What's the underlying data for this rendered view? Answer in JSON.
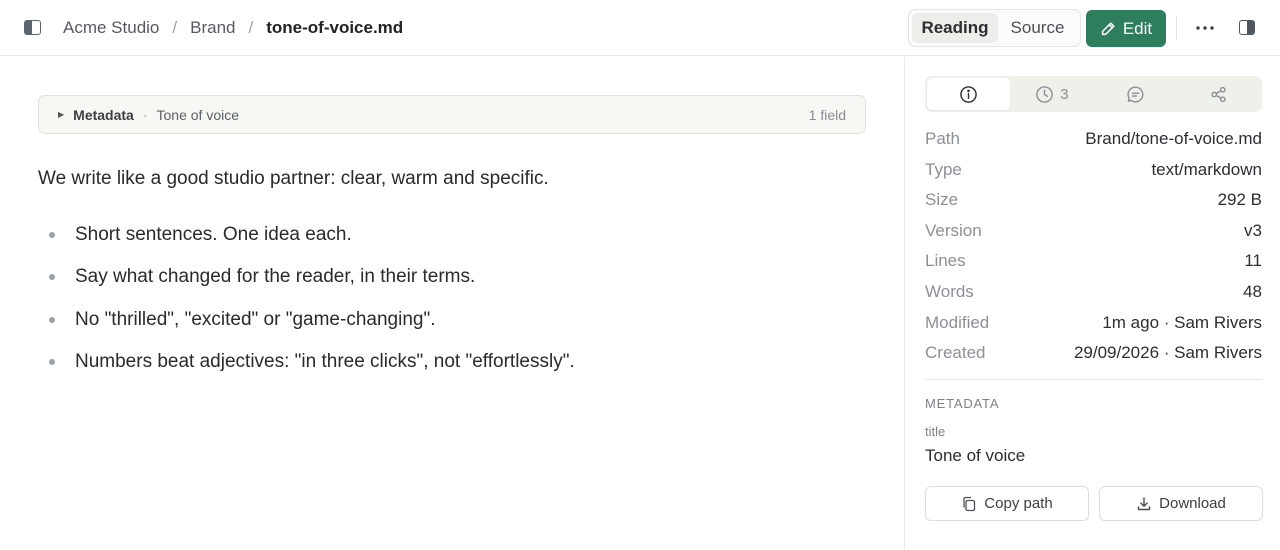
{
  "breadcrumb": [
    "Acme Studio",
    "Brand",
    "tone-of-voice.md"
  ],
  "toolbar": {
    "reading_label": "Reading",
    "source_label": "Source",
    "edit_label": "Edit",
    "accent_color": "#2e7d5c"
  },
  "metadata_bar": {
    "label": "Metadata",
    "title": "Tone of voice",
    "count": "1 field"
  },
  "document": {
    "paragraph": "We write like a good studio partner: clear, warm and specific.",
    "bullets": [
      "Short sentences. One idea each.",
      "Say what changed for the reader, in their terms.",
      "No \"thrilled\", \"excited\" or \"game-changing\".",
      "Numbers beat adjectives: \"in three clicks\", not \"effortlessly\"."
    ]
  },
  "panel": {
    "tabs": [
      {
        "icon": "info-icon",
        "count": ""
      },
      {
        "icon": "history-icon",
        "count": "3"
      },
      {
        "icon": "comment-icon",
        "count": ""
      },
      {
        "icon": "share-icon",
        "count": ""
      }
    ],
    "properties": [
      {
        "key": "Path",
        "value": "Brand/tone-of-voice.md"
      },
      {
        "key": "Type",
        "value": "text/markdown"
      },
      {
        "key": "Size",
        "value": "292 B"
      },
      {
        "key": "Version",
        "value": "v3"
      },
      {
        "key": "Lines",
        "value": "11"
      },
      {
        "key": "Words",
        "value": "48"
      },
      {
        "key": "Modified",
        "value": "1m ago · Sam Rivers"
      },
      {
        "key": "Created",
        "value": "29/09/2026 · Sam Rivers"
      }
    ],
    "metadata_heading": "METADATA",
    "metadata_key": "title",
    "metadata_value": "Tone of voice",
    "copy_label": "Copy path",
    "download_label": "Download"
  }
}
